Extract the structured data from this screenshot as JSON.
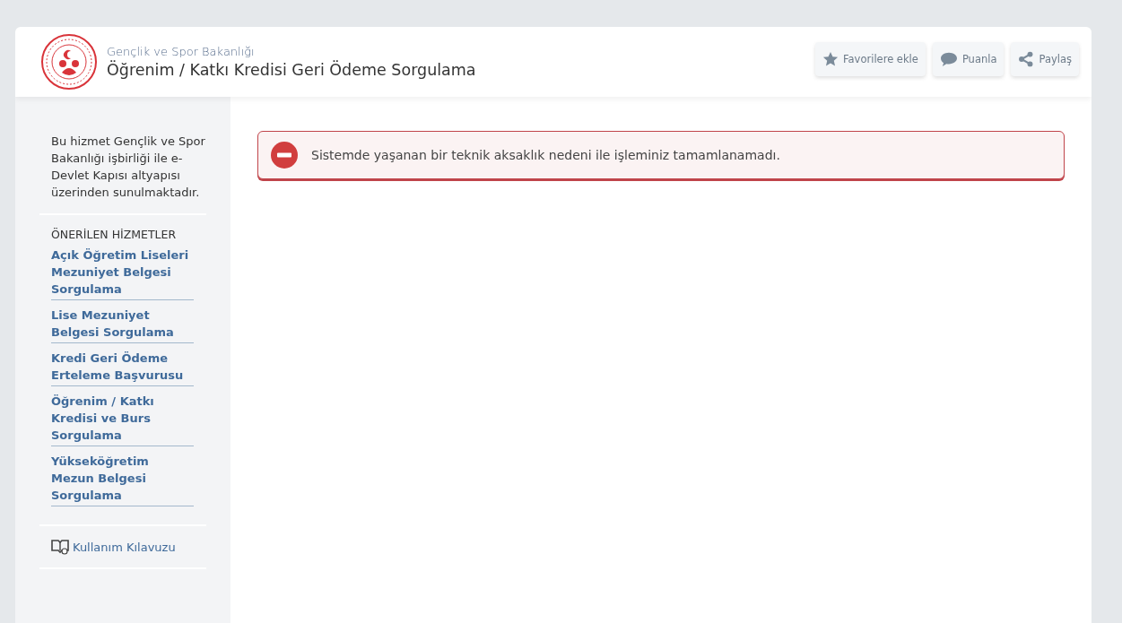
{
  "header": {
    "ministry": "Gençlik ve Spor Bakanlığı",
    "title": "Öğrenim / Katkı Kredisi Geri Ödeme Sorgulama",
    "actions": [
      {
        "kind": "star",
        "label": "Favorilere ekle"
      },
      {
        "kind": "comment",
        "label": "Puanla"
      },
      {
        "kind": "share",
        "label": "Paylaş"
      }
    ]
  },
  "sidebar": {
    "intro": "Bu hizmet Gençlik ve Spor Bakanlığı işbirliği ile e-Devlet Kapısı altyapısı üzerinden sunulmaktadır.",
    "related_heading": "ÖNERİLEN HİZMETLER",
    "related": [
      "Açık Öğretim Liseleri Mezuniyet Belgesi Sorgulama",
      "Lise Mezuniyet Belgesi Sorgulama",
      "Kredi Geri Ödeme Erteleme Başvurusu",
      "Öğrenim / Katkı Kredisi ve Burs Sorgulama",
      "Yükseköğretim Mezun Belgesi Sorgulama"
    ],
    "guide": "Kullanım Kılavuzu"
  },
  "alert": {
    "kind": "error",
    "message": "Sistemde yaşanan bir teknik aksaklık nedeni ile işleminiz tamamlanamadı."
  }
}
